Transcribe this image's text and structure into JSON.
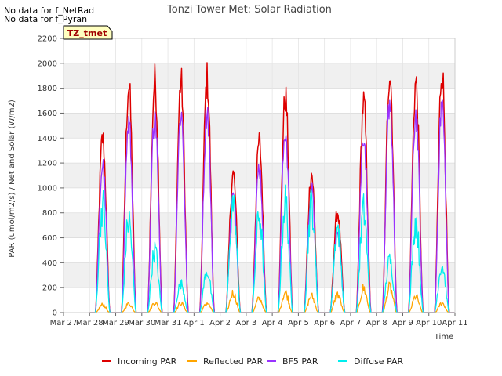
{
  "notes": [
    "No data for f_NetRad",
    "No data for f_Pyran"
  ],
  "badge": "TZ_tmet",
  "chart_data": {
    "type": "line",
    "title": "Tonzi Tower Met: Solar Radiation",
    "xlabel": "Time",
    "ylabel": "PAR (umol/m2/s) / Net and Solar (W/m2)",
    "ylim": [
      0,
      2200
    ],
    "yticks": [
      0,
      200,
      400,
      600,
      800,
      1000,
      1200,
      1400,
      1600,
      1800,
      2000,
      2200
    ],
    "xtick_labels": [
      "Mar 27",
      "Mar 28",
      "Mar 29",
      "Mar 30",
      "Mar 31",
      "Apr 1",
      "Apr 2",
      "Apr 3",
      "Apr 4",
      "Apr 5",
      "Apr 6",
      "Apr 7",
      "Apr 8",
      "Apr 9",
      "Apr 10",
      "Apr 11"
    ],
    "x_day_labels": [
      "Mar 28",
      "Mar 29",
      "Mar 30",
      "Mar 31",
      "Apr 1",
      "Apr 2",
      "Apr 3",
      "Apr 4",
      "Apr 5",
      "Apr 6",
      "Apr 7",
      "Apr 8",
      "Apr 9",
      "Apr 10"
    ],
    "grid": true,
    "series": [
      {
        "name": "Incoming PAR",
        "color": "#dd0000",
        "daily_peak": [
          1510,
          1970,
          2010,
          2005,
          2025,
          1200,
          1480,
          1870,
          1210,
          870,
          1820,
          2095,
          1990,
          2100
        ]
      },
      {
        "name": "Reflected PAR",
        "color": "#ffa500",
        "daily_peak": [
          80,
          90,
          100,
          95,
          95,
          195,
          140,
          200,
          165,
          180,
          240,
          250,
          160,
          95
        ]
      },
      {
        "name": "BF5 PAR",
        "color": "#9933ff",
        "daily_peak": [
          1280,
          1640,
          1750,
          1740,
          1760,
          1010,
          1270,
          1580,
          1070,
          720,
          1550,
          1840,
          1720,
          1820
        ]
      },
      {
        "name": "Diffuse PAR",
        "color": "#00eeee",
        "daily_peak": [
          930,
          800,
          540,
          250,
          360,
          950,
          840,
          960,
          940,
          730,
          880,
          450,
          790,
          410
        ]
      }
    ]
  }
}
